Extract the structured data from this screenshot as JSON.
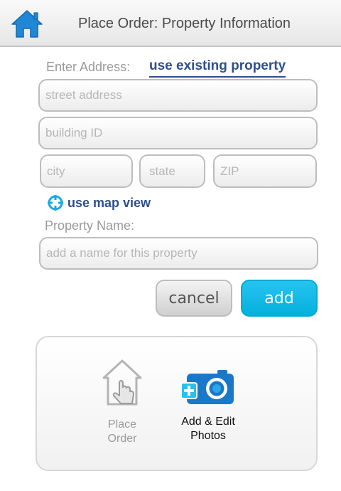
{
  "header": {
    "title": "Place Order: Property Information",
    "home_icon": "home-icon",
    "icon_color": "#1e88d6"
  },
  "address": {
    "label": "Enter Address:",
    "existing_link": "use existing property",
    "street_placeholder": "street address",
    "building_placeholder": "building ID",
    "city_placeholder": "city",
    "state_placeholder": "state",
    "zip_placeholder": "ZIP"
  },
  "map": {
    "label": "use map view",
    "icon": "map-crosshair-icon"
  },
  "property": {
    "label": "Property Name:",
    "name_placeholder": "add a name for this property"
  },
  "actions": {
    "cancel_label": "cancel",
    "add_label": "add",
    "add_color": "#06b4e3"
  },
  "toolbar": {
    "place_order_label_1": "Place",
    "place_order_label_2": "Order",
    "photos_label_1": "Add & Edit",
    "photos_label_2": "Photos",
    "place_order_icon": "house-hand-icon",
    "photos_icon": "camera-plus-icon"
  }
}
